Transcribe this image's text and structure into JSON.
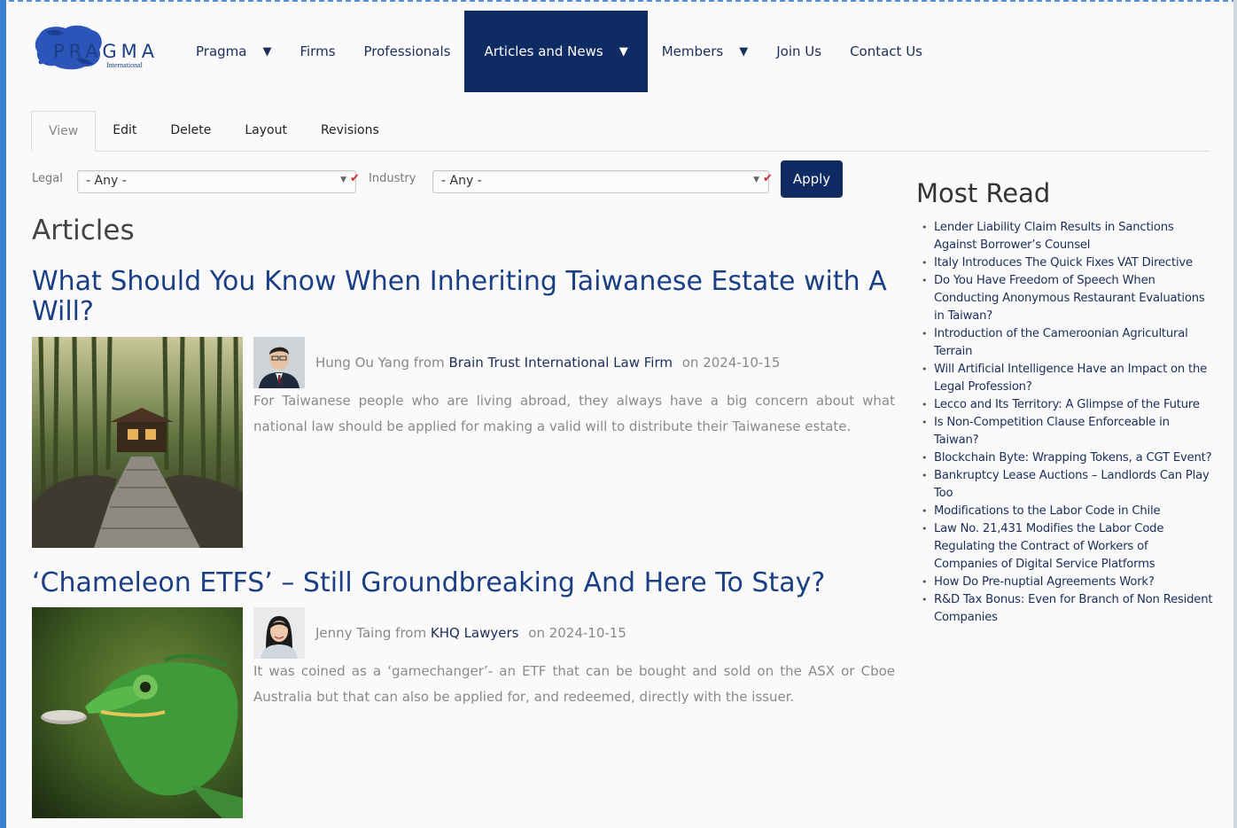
{
  "brand": {
    "logo_text": "PRAGMA",
    "logo_subtext": "International",
    "brand_color": "#1b3f84",
    "accent_color": "#0e2b63"
  },
  "nav": {
    "items": [
      {
        "label": "Pragma",
        "has_dropdown": true,
        "active": false
      },
      {
        "label": "Firms",
        "has_dropdown": false,
        "active": false
      },
      {
        "label": "Professionals",
        "has_dropdown": false,
        "active": false
      },
      {
        "label": "Articles and News",
        "has_dropdown": true,
        "active": true
      },
      {
        "label": "Members",
        "has_dropdown": true,
        "active": false
      },
      {
        "label": "Join Us",
        "has_dropdown": false,
        "active": false
      },
      {
        "label": "Contact Us",
        "has_dropdown": false,
        "active": false
      }
    ],
    "dropdown_icon": "▼"
  },
  "tabs": [
    {
      "label": "View",
      "active": true
    },
    {
      "label": "Edit",
      "active": false
    },
    {
      "label": "Delete",
      "active": false
    },
    {
      "label": "Layout",
      "active": false
    },
    {
      "label": "Revisions",
      "active": false
    }
  ],
  "filters": {
    "legal_label": "Legal",
    "legal_value": "- Any -",
    "industry_label": "Industry",
    "industry_value": "- Any -",
    "apply_label": "Apply"
  },
  "main": {
    "section_title": "Articles",
    "articles": [
      {
        "title": "What Should You Know When Inheriting Taiwanese Estate with A Will?",
        "author": "Hung Ou Yang",
        "from_text": "from",
        "firm": "Brain Trust International Law Firm",
        "date_text": "on 2024-10-15",
        "excerpt": "For Taiwanese people who are living abroad, they always have a big concern about what national law should be applied for making a valid will to distribute their Taiwanese estate.",
        "image": "bamboo-forest-path-image",
        "avatar": "male-author-avatar"
      },
      {
        "title": "‘Chameleon ETFS’ – Still Groundbreaking And Here To Stay?",
        "author": "Jenny Taing",
        "from_text": "from",
        "firm": "KHQ Lawyers",
        "date_text": "on 2024-10-15",
        "excerpt": "It was coined as a ‘gamechanger’- an ETF that can be bought and sold on the ASX or Cboe Australia but that can also be applied for, and redeemed, directly with the issuer.",
        "image": "chameleon-coin-image",
        "avatar": "female-author-avatar"
      }
    ]
  },
  "sidebar": {
    "title": "Most Read",
    "items": [
      "Lender Liability Claim Results in Sanctions Against Borrower’s Counsel",
      "Italy Introduces The Quick Fixes VAT Directive",
      "Do You Have Freedom of Speech When Conducting Anonymous Restaurant Evaluations in Taiwan?",
      "Introduction of the Cameroonian Agricultural Terrain",
      "Will Artificial Intelligence Have an Impact on the Legal Profession?",
      "Lecco and Its Territory: A Glimpse of the Future",
      "Is Non-Competition Clause Enforceable in Taiwan?",
      "Blockchain Byte: Wrapping Tokens, a CGT Event?",
      "Bankruptcy Lease Auctions – Landlords Can Play Too",
      "Modifications to the Labor Code in Chile",
      "Law No. 21,431 Modifies the Labor Code Regulating the Contract of Workers of Companies of Digital Service Platforms",
      "How Do Pre-nuptial Agreements Work?",
      "R&D Tax Bonus: Even for Branch of Non Resident Companies"
    ]
  }
}
